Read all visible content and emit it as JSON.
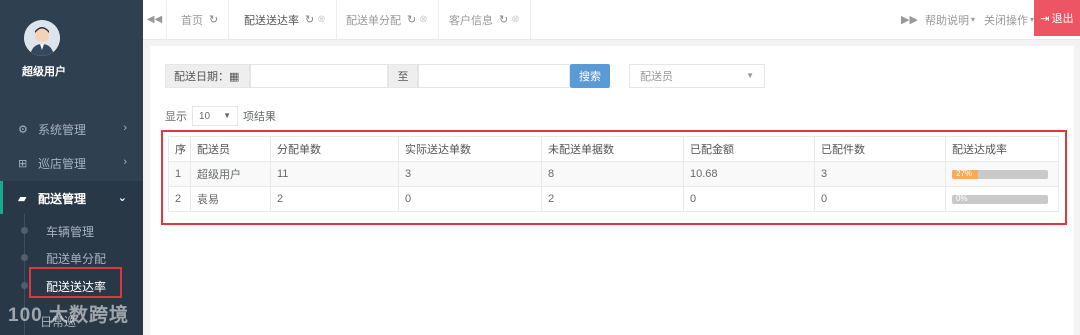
{
  "sidebar": {
    "user_name": "超级用户",
    "menu": [
      {
        "label": "系统管理",
        "icon": "gears-icon"
      },
      {
        "label": "巡店管理",
        "icon": "sitemap-icon"
      },
      {
        "label": "配送管理",
        "icon": "truck-icon"
      }
    ],
    "submenu": [
      "车辆管理",
      "配送单分配",
      "配送送达率",
      "日常巡"
    ],
    "watermark": "100 大数跨境"
  },
  "tabs": {
    "home": "首页",
    "items": [
      "配送送达率",
      "配送单分配",
      "客户信息"
    ],
    "help": "帮助说明",
    "close_ops": "关闭操作",
    "logout": "退出"
  },
  "filter": {
    "date_label": "配送日期：",
    "to_label": "至",
    "search_button": "搜索",
    "courier_placeholder": "配送员"
  },
  "table_length": {
    "prefix": "显示",
    "value": "10",
    "suffix": "项结果"
  },
  "table": {
    "headers": [
      "序",
      "配送员",
      "分配单数",
      "实际送达单数",
      "未配送单据数",
      "已配金额",
      "已配件数",
      "配送达成率"
    ],
    "rows": [
      {
        "no": "1",
        "courier": "超级用户",
        "assigned": "11",
        "delivered": "3",
        "undelivered": "8",
        "amount": "10.68",
        "pieces": "3",
        "rate_label": "27%",
        "rate": 0.27
      },
      {
        "no": "2",
        "courier": "袁易",
        "assigned": "2",
        "delivered": "0",
        "undelivered": "2",
        "amount": "0",
        "pieces": "0",
        "rate_label": "0%",
        "rate": 0
      }
    ]
  },
  "colors": {
    "sidebar_bg": "#2f4050",
    "accent_red": "#e0373f",
    "progress": "#f8ac59",
    "search_btn": "#5b9bd5",
    "logout_bg": "#ed5565"
  }
}
